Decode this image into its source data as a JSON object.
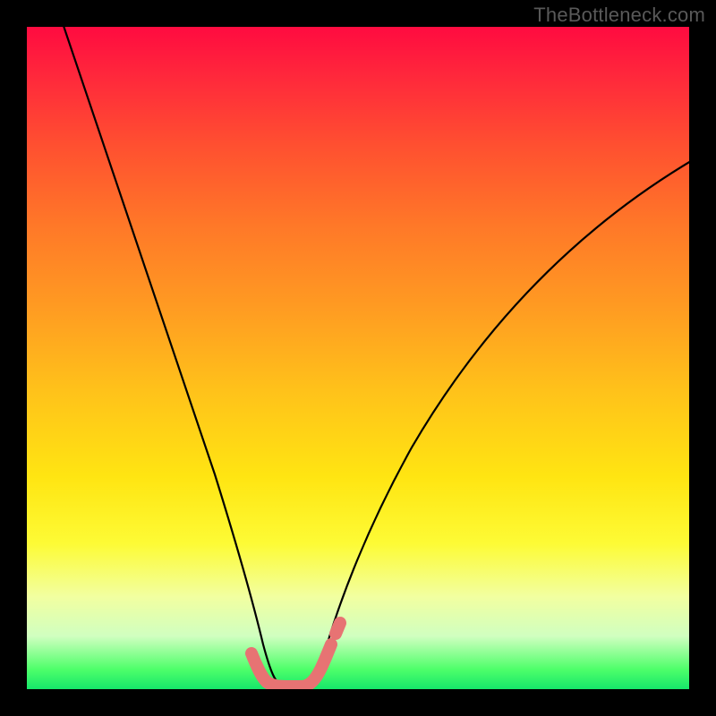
{
  "watermark": "TheBottleneck.com",
  "chart_data": {
    "type": "line",
    "title": "",
    "xlabel": "",
    "ylabel": "",
    "xlim": [
      0,
      100
    ],
    "ylim": [
      0,
      100
    ],
    "grid": false,
    "legend": false,
    "series": [
      {
        "name": "bottleneck-curve",
        "x": [
          5,
          10,
          15,
          20,
          25,
          28,
          31,
          33,
          35,
          36,
          37,
          38,
          40,
          42,
          43,
          44,
          46,
          50,
          56,
          62,
          70,
          78,
          86,
          94,
          100
        ],
        "y": [
          100,
          85,
          68,
          50,
          32,
          20,
          10,
          5,
          2,
          1,
          0,
          0,
          0,
          0,
          1,
          2,
          4,
          8,
          16,
          24,
          34,
          44,
          53,
          62,
          68
        ]
      },
      {
        "name": "thick-marker-segment",
        "x": [
          33,
          34.5,
          35.5,
          36.5,
          38,
          40,
          42,
          43,
          44,
          45.5
        ],
        "y": [
          5,
          3,
          1.5,
          0.8,
          0.5,
          0.5,
          0.6,
          1.2,
          2.4,
          4.2
        ]
      }
    ],
    "colors": {
      "background_gradient": [
        "#ff0b40",
        "#ff5030",
        "#ff9a22",
        "#ffe512",
        "#f2ffa0",
        "#16e66a"
      ],
      "curve": "#000000",
      "marker": "#e77373"
    }
  }
}
